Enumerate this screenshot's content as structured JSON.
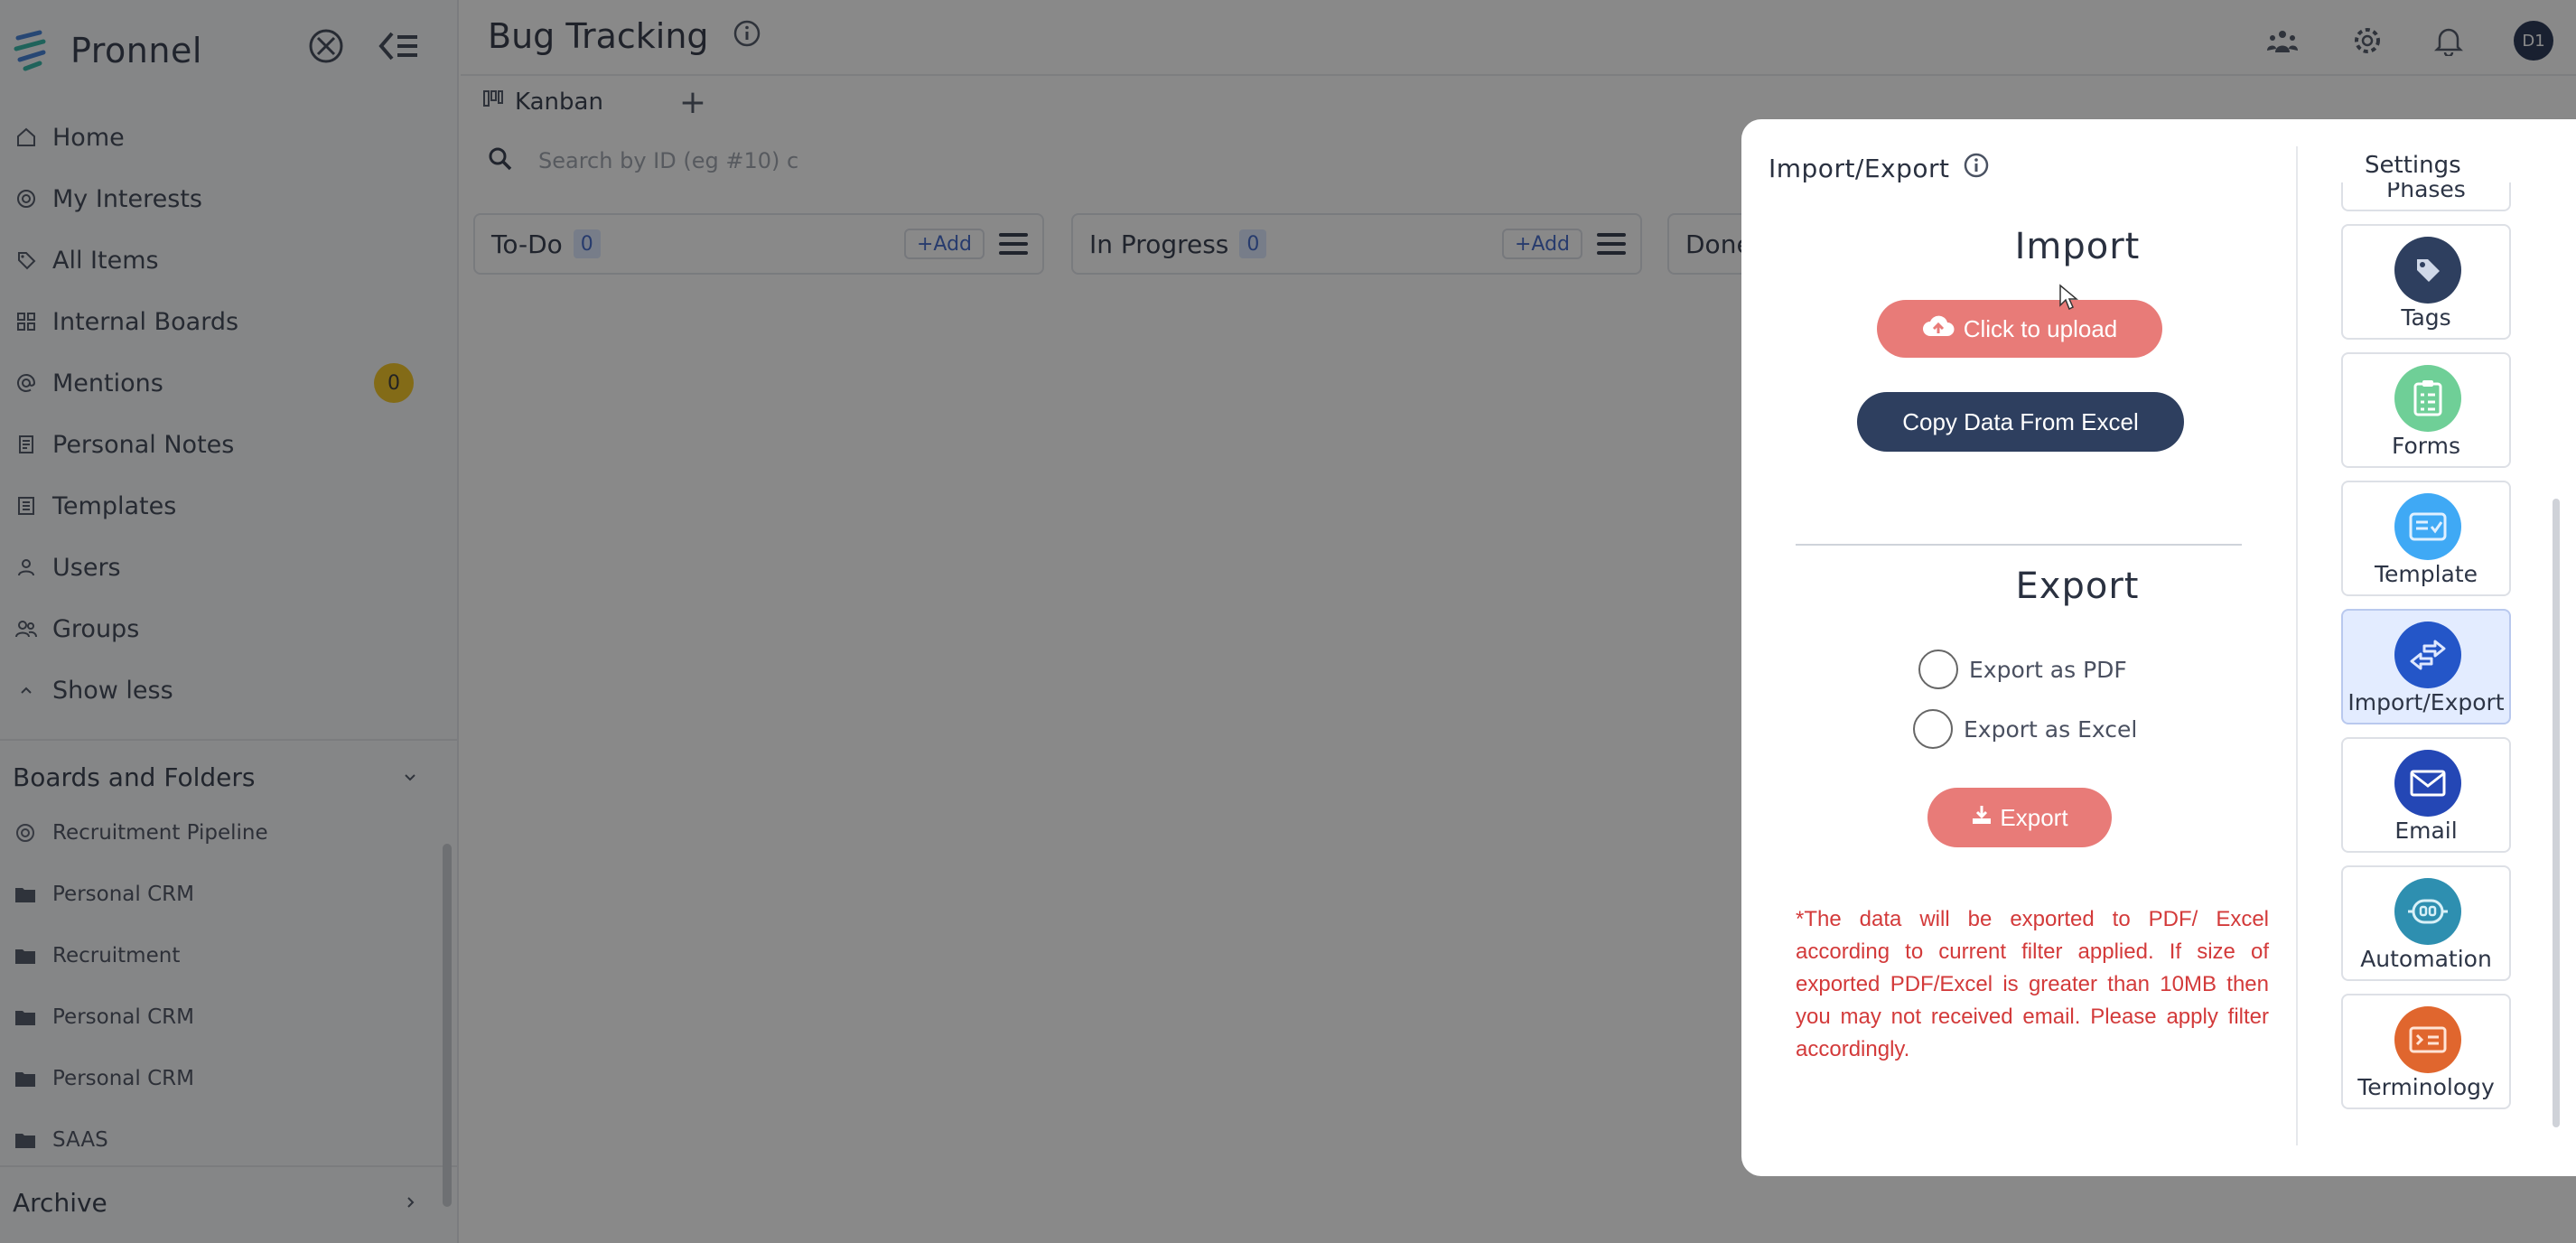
{
  "app": {
    "brand": "Pronnel",
    "colors": {
      "accent": "#e87b78",
      "navy": "#2e3f5f",
      "badge": "#f2c21b",
      "note": "#d33a3a"
    }
  },
  "sidebar": {
    "items": [
      {
        "label": "Home",
        "icon": "home-icon"
      },
      {
        "label": "My Interests",
        "icon": "target-icon"
      },
      {
        "label": "All Items",
        "icon": "tag-icon"
      },
      {
        "label": "Internal Boards",
        "icon": "grid-icon"
      },
      {
        "label": "Mentions",
        "icon": "at-icon",
        "badge": "0"
      },
      {
        "label": "Personal Notes",
        "icon": "note-icon"
      },
      {
        "label": "Templates",
        "icon": "template-icon"
      },
      {
        "label": "Users",
        "icon": "user-icon"
      },
      {
        "label": "Groups",
        "icon": "group-icon"
      },
      {
        "label": "Show less",
        "icon": "chevron-up-icon"
      }
    ],
    "boards_title": "Boards and Folders",
    "boards": [
      {
        "label": "Recruitment Pipeline",
        "icon": "target-icon"
      },
      {
        "label": "Personal CRM",
        "icon": "folder-icon"
      },
      {
        "label": "Recruitment",
        "icon": "folder-icon"
      },
      {
        "label": "Personal CRM",
        "icon": "folder-icon"
      },
      {
        "label": "Personal CRM",
        "icon": "folder-icon"
      },
      {
        "label": "SAAS",
        "icon": "folder-icon"
      }
    ],
    "archive": "Archive"
  },
  "header": {
    "title": "Bug Tracking",
    "avatar_initials": "D1"
  },
  "tabs": [
    {
      "label": "Kanban"
    }
  ],
  "search": {
    "placeholder": "Search by ID (eg #10) c"
  },
  "columns": [
    {
      "title": "To-Do",
      "count": "0",
      "add_label": "+Add"
    },
    {
      "title": "In Progress",
      "count": "0",
      "add_label": "+Add"
    },
    {
      "title": "Done"
    }
  ],
  "modal": {
    "title": "Import/Export",
    "import_heading": "Import",
    "upload_label": "Click to upload",
    "copy_excel_label": "Copy Data From Excel",
    "export_heading": "Export",
    "export_pdf_label": "Export as PDF",
    "export_excel_label": "Export as Excel",
    "export_button_label": "Export",
    "note": "*The data will be exported to PDF/ Excel according to current filter applied. If size of exported PDF/Excel is greater than 10MB then you may not received email. Please apply filter accordingly."
  },
  "settings": {
    "title": "Settings",
    "items": [
      {
        "label": "Phases",
        "color": "#ffffff"
      },
      {
        "label": "Tags",
        "color": "#2e3f5f"
      },
      {
        "label": "Forms",
        "color": "#6fcf97"
      },
      {
        "label": "Template",
        "color": "#3fa9f5"
      },
      {
        "label": "Import/Export",
        "color": "#2456c8",
        "active": true
      },
      {
        "label": "Email",
        "color": "#2447b5"
      },
      {
        "label": "Automation",
        "color": "#2e8fb0"
      },
      {
        "label": "Terminology",
        "color": "#e0662e"
      }
    ]
  }
}
